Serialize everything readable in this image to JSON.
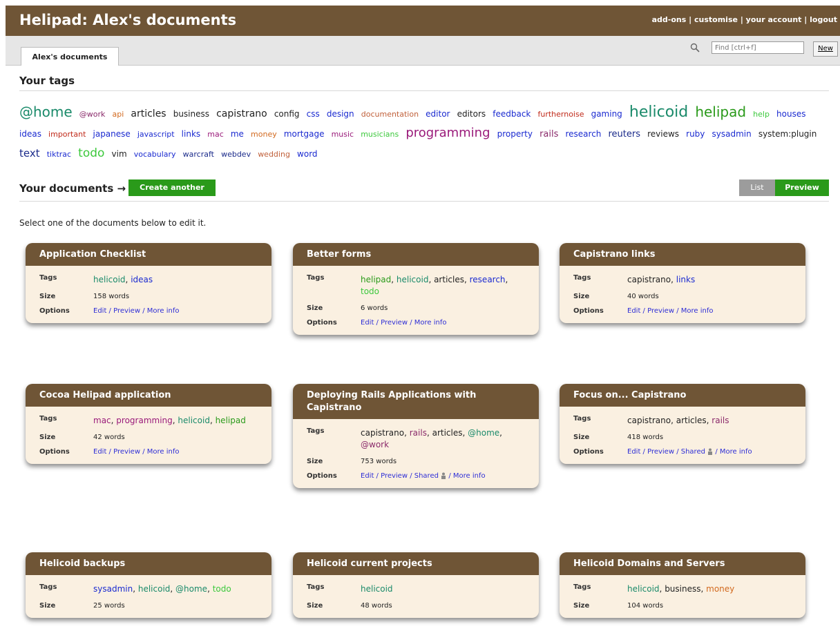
{
  "header": {
    "title": "Helipad: Alex's documents",
    "links": [
      "add-ons",
      "customise",
      "your account",
      "logout"
    ]
  },
  "tabs": {
    "active": "Alex's documents"
  },
  "search": {
    "placeholder": "Find [ctrl+f]",
    "new_label": "New"
  },
  "tags_section": {
    "title": "Your tags",
    "tags": [
      {
        "label": "@home",
        "size": 20,
        "color": "#1a8a6a"
      },
      {
        "label": "@work",
        "size": 11,
        "color": "#8a2a6a"
      },
      {
        "label": "api",
        "size": 11,
        "color": "#d2691e"
      },
      {
        "label": "articles",
        "size": 14,
        "color": "#222222"
      },
      {
        "label": "business",
        "size": 12,
        "color": "#222222"
      },
      {
        "label": "capistrano",
        "size": 14,
        "color": "#222222"
      },
      {
        "label": "config",
        "size": 12,
        "color": "#222222"
      },
      {
        "label": "css",
        "size": 12,
        "color": "#1a2ad0"
      },
      {
        "label": "design",
        "size": 12,
        "color": "#1a2ad0"
      },
      {
        "label": "documentation",
        "size": 11,
        "color": "#c0603a"
      },
      {
        "label": "editor",
        "size": 12,
        "color": "#1a2ad0"
      },
      {
        "label": "editors",
        "size": 12,
        "color": "#222222"
      },
      {
        "label": "feedback",
        "size": 12,
        "color": "#1a2ad0"
      },
      {
        "label": "furthernoise",
        "size": 11,
        "color": "#c02a1a"
      },
      {
        "label": "gaming",
        "size": 12,
        "color": "#1a2ad0"
      },
      {
        "label": "helicoid",
        "size": 22,
        "color": "#1a8a6a"
      },
      {
        "label": "helipad",
        "size": 20,
        "color": "#2a9a1a"
      },
      {
        "label": "help",
        "size": 11,
        "color": "#3cc83c"
      },
      {
        "label": "houses",
        "size": 12,
        "color": "#1a2ad0"
      },
      {
        "label": "ideas",
        "size": 12,
        "color": "#1a2ad0"
      },
      {
        "label": "important",
        "size": 11,
        "color": "#c02a1a"
      },
      {
        "label": "japanese",
        "size": 12,
        "color": "#1a2ad0"
      },
      {
        "label": "javascript",
        "size": 11,
        "color": "#1a2ad0"
      },
      {
        "label": "links",
        "size": 12,
        "color": "#1a2ad0"
      },
      {
        "label": "mac",
        "size": 11,
        "color": "#9a1a7a"
      },
      {
        "label": "me",
        "size": 12,
        "color": "#1a2ad0"
      },
      {
        "label": "money",
        "size": 11,
        "color": "#d2691e"
      },
      {
        "label": "mortgage",
        "size": 12,
        "color": "#1a2ad0"
      },
      {
        "label": "music",
        "size": 11,
        "color": "#9a1a7a"
      },
      {
        "label": "musicians",
        "size": 11,
        "color": "#3cc83c"
      },
      {
        "label": "programming",
        "size": 18,
        "color": "#9a1a7a"
      },
      {
        "label": "property",
        "size": 12,
        "color": "#1a2ad0"
      },
      {
        "label": "rails",
        "size": 13,
        "color": "#8a2a6a"
      },
      {
        "label": "research",
        "size": 12,
        "color": "#1a2ad0"
      },
      {
        "label": "reuters",
        "size": 13,
        "color": "#1a2a8a"
      },
      {
        "label": "reviews",
        "size": 12,
        "color": "#222222"
      },
      {
        "label": "ruby",
        "size": 12,
        "color": "#1a2ad0"
      },
      {
        "label": "sysadmin",
        "size": 12,
        "color": "#1a2ad0"
      },
      {
        "label": "system:plugin",
        "size": 12,
        "color": "#222222"
      },
      {
        "label": "text",
        "size": 15,
        "color": "#1a2a8a"
      },
      {
        "label": "tiktrac",
        "size": 11,
        "color": "#1a2ad0"
      },
      {
        "label": "todo",
        "size": 17,
        "color": "#3cc83c"
      },
      {
        "label": "vim",
        "size": 12,
        "color": "#222222"
      },
      {
        "label": "vocabulary",
        "size": 11,
        "color": "#1a2ad0"
      },
      {
        "label": "warcraft",
        "size": 11,
        "color": "#1a2a8a"
      },
      {
        "label": "webdev",
        "size": 11,
        "color": "#1a2a8a"
      },
      {
        "label": "wedding",
        "size": 11,
        "color": "#c0603a"
      },
      {
        "label": "word",
        "size": 12,
        "color": "#1a2ad0"
      }
    ]
  },
  "documents_section": {
    "title": "Your documents →",
    "create_label": "Create another",
    "list_label": "List",
    "preview_label": "Preview",
    "intro": "Select one of the documents below to edit it.",
    "field_labels": {
      "tags": "Tags",
      "size": "Size",
      "options": "Options"
    },
    "documents": [
      {
        "title": "Application Checklist",
        "tags": [
          "helicoid",
          "ideas"
        ],
        "size": "158 words",
        "options": "Edit / Preview / More info"
      },
      {
        "title": "Better forms",
        "tags": [
          "helipad",
          "helicoid",
          "articles",
          "research",
          "todo"
        ],
        "size": "6 words",
        "options": "Edit / Preview / More info"
      },
      {
        "title": "Capistrano links",
        "tags": [
          "capistrano",
          "links"
        ],
        "size": "40 words",
        "options": "Edit / Preview / More info"
      },
      {
        "title": "Cocoa Helipad application",
        "tags": [
          "mac",
          "programming",
          "helicoid",
          "helipad"
        ],
        "size": "42 words",
        "options": "Edit / Preview / More info"
      },
      {
        "title": "Deploying Rails Applications with Capistrano",
        "tags": [
          "capistrano",
          "rails",
          "articles",
          "@home",
          "@work"
        ],
        "size": "753 words",
        "options": "Edit / Preview / Shared",
        "options_more": "/ More info",
        "shared": true
      },
      {
        "title": "Focus on... Capistrano",
        "tags": [
          "capistrano",
          "articles",
          "rails"
        ],
        "size": "418 words",
        "options": "Edit / Preview / Shared",
        "options_more": "/ More info",
        "shared": true
      },
      {
        "title": "Helicoid backups",
        "tags": [
          "sysadmin",
          "helicoid",
          "@home",
          "todo"
        ],
        "size": "25 words",
        "options": ""
      },
      {
        "title": "Helicoid current projects",
        "tags": [
          "helicoid"
        ],
        "size": "48 words",
        "options": ""
      },
      {
        "title": "Helicoid Domains and Servers",
        "tags": [
          "helicoid",
          "business",
          "money"
        ],
        "size": "104 words",
        "options": ""
      }
    ]
  }
}
